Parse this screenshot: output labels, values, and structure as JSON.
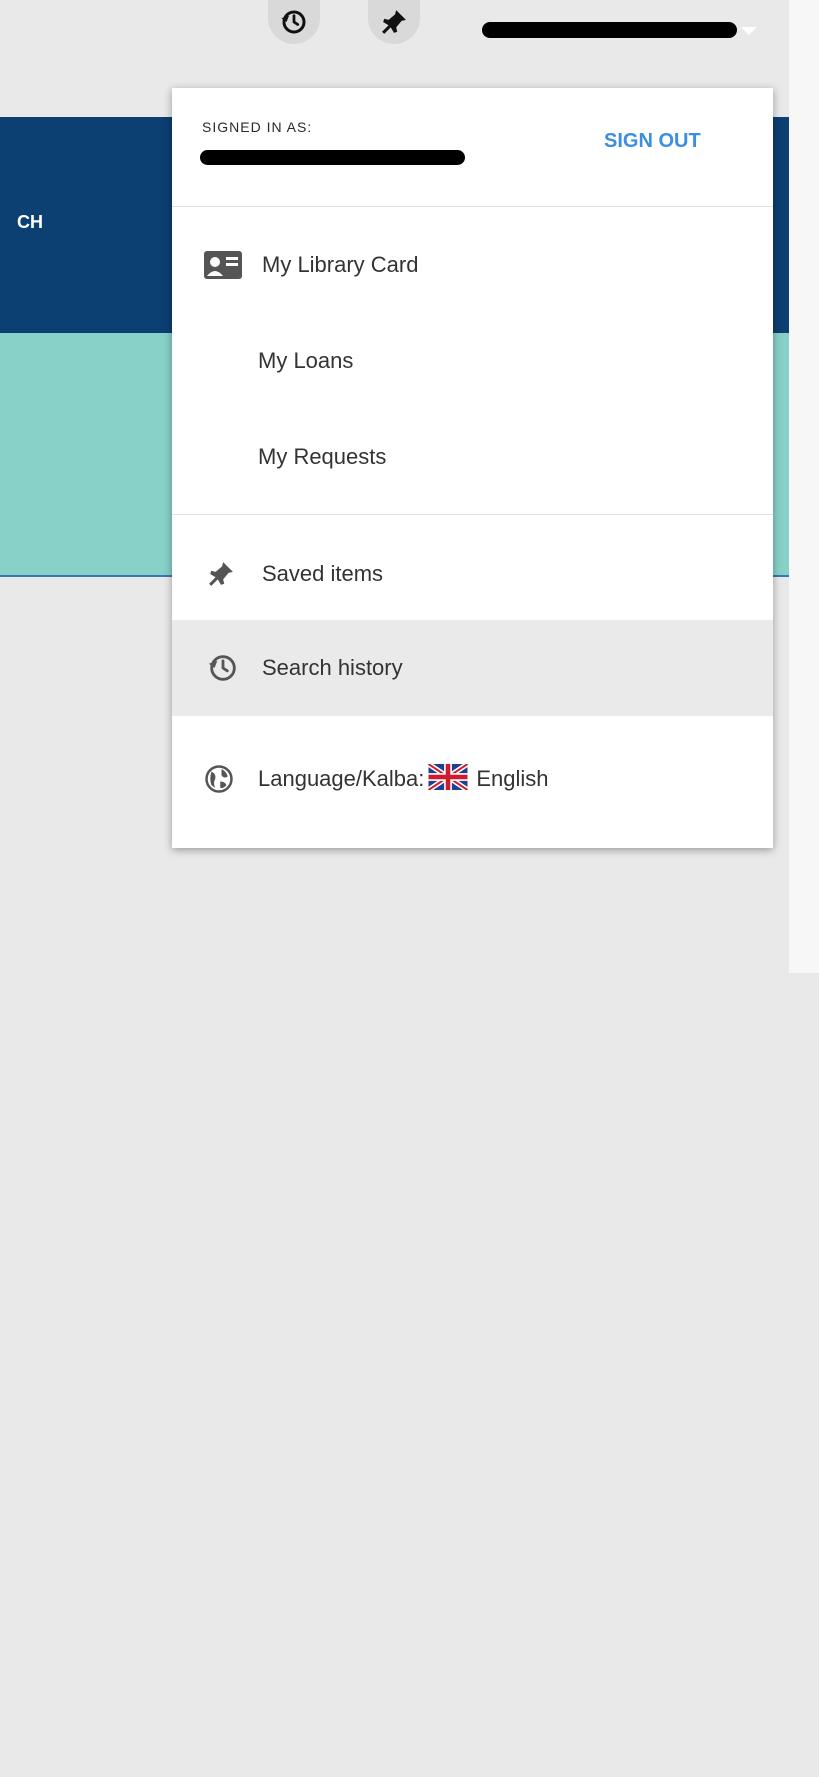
{
  "topbar": {
    "history_icon": "history-icon",
    "pin_icon": "pin-icon"
  },
  "nav": {
    "partial_label": "CH"
  },
  "menu": {
    "signed_in_label": "SIGNED IN AS:",
    "sign_out_label": "SIGN OUT",
    "items": [
      {
        "label": "My Library Card",
        "icon": "library-card-icon"
      },
      {
        "label": "My Loans"
      },
      {
        "label": "My Requests"
      },
      {
        "label": "Saved items",
        "icon": "pin-icon"
      },
      {
        "label": "Search history",
        "icon": "history-icon"
      }
    ],
    "language": {
      "label": "Language/Kalba:",
      "value": "English",
      "icon": "globe-icon",
      "flag": "uk-flag-icon"
    }
  },
  "colors": {
    "navy": "#0c3f72",
    "teal": "#87d1c9",
    "accent": "#3c8fe0"
  }
}
